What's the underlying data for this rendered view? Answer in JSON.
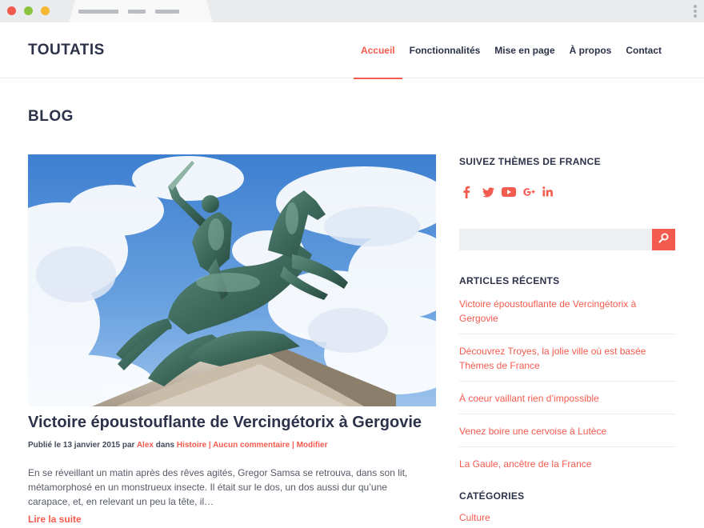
{
  "site": {
    "logo": "TOUTATIS"
  },
  "nav": [
    {
      "label": "Accueil",
      "active": true
    },
    {
      "label": "Fonctionnalités"
    },
    {
      "label": "Mise en page"
    },
    {
      "label": "À propos"
    },
    {
      "label": "Contact"
    }
  ],
  "page_title": "BLOG",
  "post": {
    "title": "Victoire époustouflante de Vercingétorix à Gergovie",
    "meta_prefix": "Publié le 13 janvier 2015 par ",
    "author": "Alex",
    "meta_in": " dans ",
    "category": "Histoire",
    "sep1": " | ",
    "comments": "Aucun commentaire",
    "sep2": " | ",
    "edit": "Modifier",
    "excerpt": "En se réveillant un matin après des rêves agités, Gregor Samsa se retrouva, dans son lit, métamorphosé en un monstrueux insecte. Il était sur le dos, un dos aussi dur qu’une carapace, et, en relevant un peu la tête, il…",
    "read_more": "Lire la suite"
  },
  "sidebar": {
    "follow_title": "SUIVEZ THÈMES DE FRANCE",
    "socials": [
      "facebook-icon",
      "twitter-icon",
      "youtube-icon",
      "google-plus-icon",
      "linkedin-icon"
    ],
    "search_placeholder": "",
    "recent_title": "ARTICLES RÉCENTS",
    "recent": [
      "Victoire époustouflante de Vercingétorix à Gergovie",
      "Découvrez Troyes, la jolie ville où est basée Thèmes de France",
      "À coeur vaillant rien d’impossible",
      "Venez boire une cervoise à Lutèce",
      "La Gaule, ancêtre de la France"
    ],
    "categories_title": "CATÉGORIES",
    "categories": [
      "Culture"
    ]
  },
  "colors": {
    "accent": "#f35b4f",
    "text": "#2c3249",
    "chrome": "#e9ebed"
  }
}
